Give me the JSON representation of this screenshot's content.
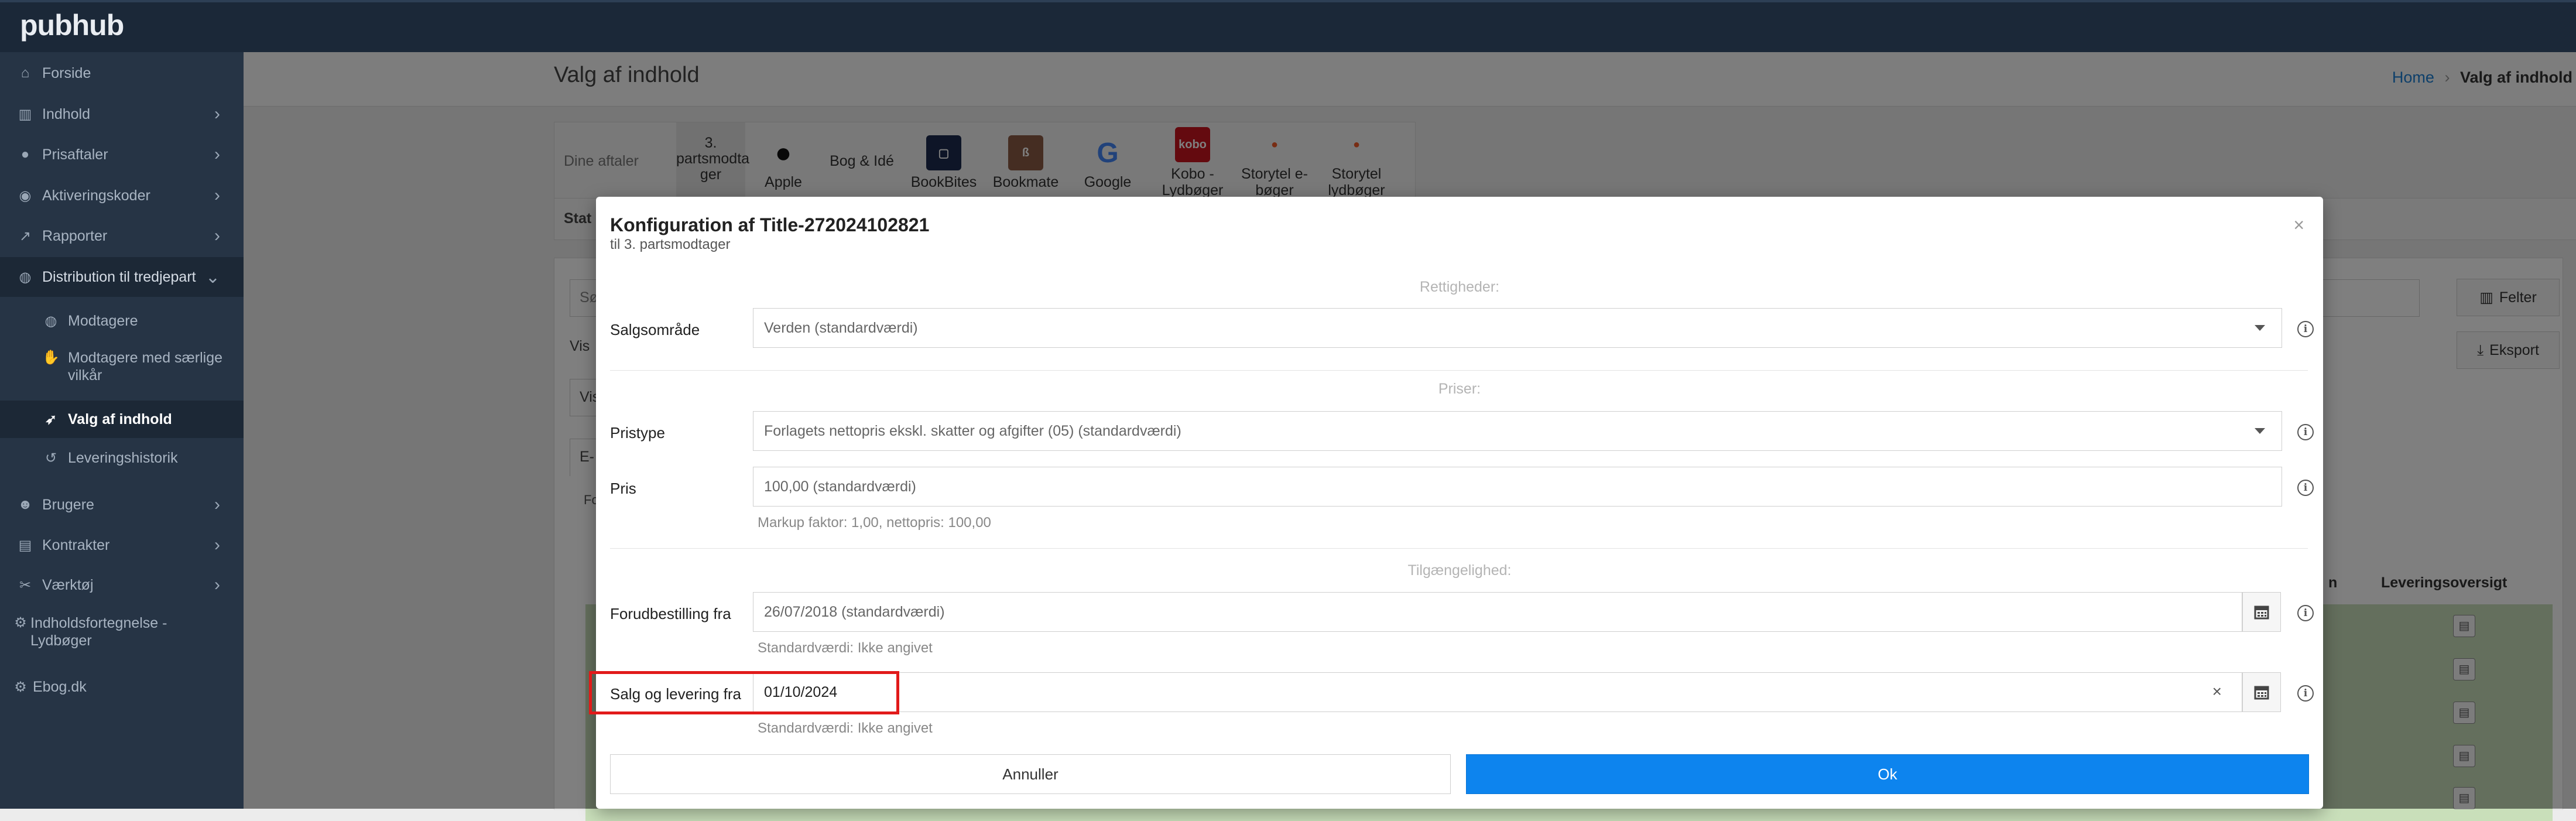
{
  "app": {
    "brand": "pubhub"
  },
  "sidebar": {
    "items": [
      {
        "label": "Forside",
        "icon": "home-icon"
      },
      {
        "label": "Indhold",
        "icon": "books-icon",
        "chevron": "›"
      },
      {
        "label": "Prisaftaler",
        "icon": "tag-icon",
        "chevron": "›"
      },
      {
        "label": "Aktiveringskoder",
        "icon": "key-icon",
        "chevron": "›"
      },
      {
        "label": "Rapporter",
        "icon": "chart-icon",
        "chevron": "›"
      },
      {
        "label": "Distribution til tredjepart",
        "icon": "globe-icon",
        "chevron": "⌄"
      },
      {
        "label": "Modtagere",
        "icon": "globe-small-icon"
      },
      {
        "label": "Modtagere med særlige vilkår",
        "icon": "handshake-icon"
      },
      {
        "label": "Valg af indhold",
        "icon": "rocket-icon"
      },
      {
        "label": "Leveringshistorik",
        "icon": "history-icon"
      },
      {
        "label": "Brugere",
        "icon": "users-icon",
        "chevron": "›"
      },
      {
        "label": "Kontrakter",
        "icon": "document-icon",
        "chevron": "›"
      },
      {
        "label": "Værktøj",
        "icon": "tools-icon",
        "chevron": "›"
      },
      {
        "label": "Indholdsfortegnelse - Lydbøger",
        "icon": "gear-icon"
      },
      {
        "label": "Ebog.dk",
        "icon": "gear-icon"
      }
    ]
  },
  "header": {
    "title": "Valg af indhold",
    "breadcrumb": {
      "home": "Home",
      "sep": "›",
      "current": "Valg af indhold"
    }
  },
  "background": {
    "agreements_label": "Dine aftaler",
    "partners": [
      {
        "name": "3. partsmodta ger"
      },
      {
        "name": "Apple"
      },
      {
        "name": "Bog & Idé"
      },
      {
        "name": "BookBites"
      },
      {
        "name": "Bookmate"
      },
      {
        "name": "Google"
      },
      {
        "name": "Kobo - Lydbøger"
      },
      {
        "name": "Storytel e-bøger"
      },
      {
        "name": "Storytel lydbøger"
      }
    ],
    "status_fragment": "Stat",
    "search_fragment": "Sø",
    "vis_fragment": "Vis",
    "vis2_fragment": "Vis",
    "tab_fragment": "E-",
    "filter_fragment": "Fo",
    "fields_button": "Felter",
    "export_button": "Eksport",
    "delivery_overview_header": "Leveringsoversigt",
    "col_fragment": "n"
  },
  "modal": {
    "title": "Konfiguration af Title-272024102821",
    "subtitle": "til 3. partsmodtager",
    "close": "×",
    "sections": {
      "rights": "Rettigheder:",
      "prices": "Priser:",
      "availability": "Tilgængelighed:"
    },
    "fields": {
      "sales_area": {
        "label": "Salgsområde",
        "value": "Verden (standardværdi)"
      },
      "price_type": {
        "label": "Pristype",
        "value": "Forlagets nettopris ekskl. skatter og afgifter (05) (standardværdi)"
      },
      "price": {
        "label": "Pris",
        "value": "100,00 (standardværdi)",
        "hint": "Markup faktor: 1,00, nettopris: 100,00"
      },
      "preorder_from": {
        "label": "Forudbestilling fra",
        "value": "26/07/2018 (standardværdi)",
        "hint": "Standardværdi: Ikke angivet"
      },
      "sale_delivery_from": {
        "label": "Salg og levering fra",
        "value": "01/10/2024",
        "clear": "×",
        "hint": "Standardværdi: Ikke angivet"
      }
    },
    "buttons": {
      "cancel": "Annuller",
      "ok": "Ok"
    }
  },
  "colors": {
    "topbar": "#1b2838",
    "sidebar": "#263445",
    "primary": "#0d84ee",
    "highlight": "#e11a1a"
  }
}
